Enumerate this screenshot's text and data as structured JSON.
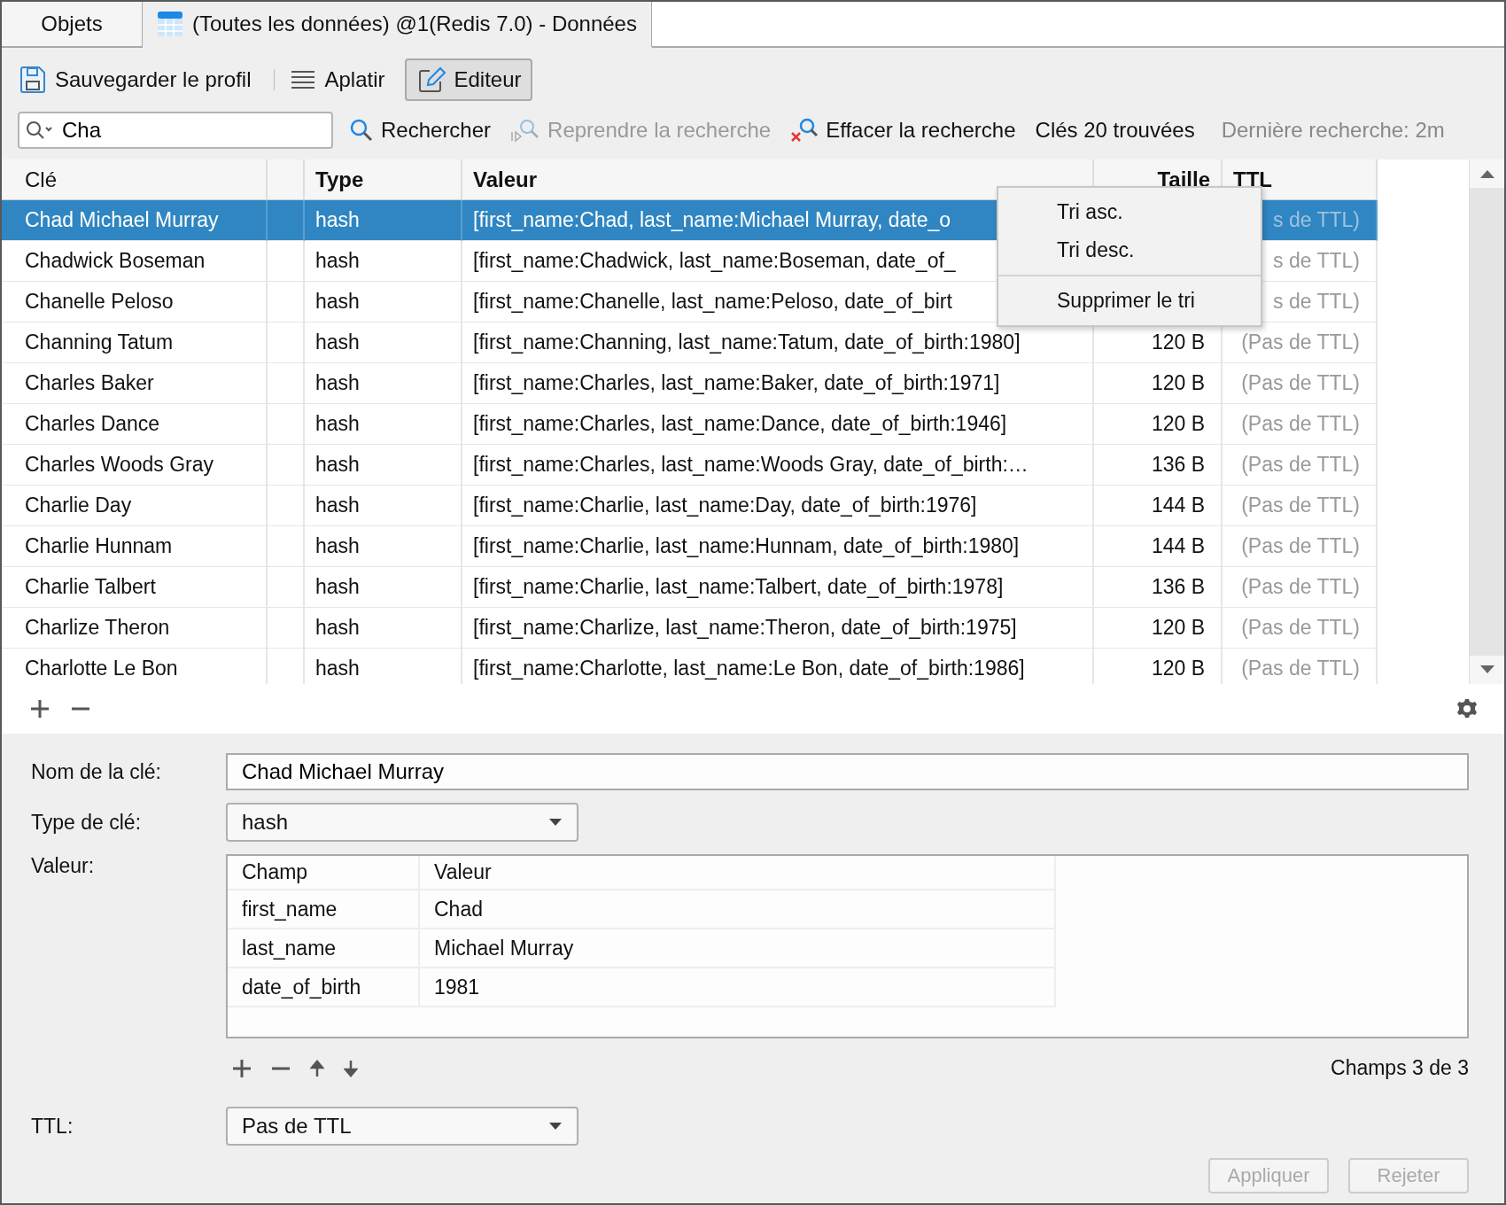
{
  "tabs": [
    {
      "label": "Objets",
      "selected": false,
      "kind": "plain"
    },
    {
      "label": "(Toutes les données) @1(Redis 7.0) - Données",
      "selected": true,
      "kind": "table"
    }
  ],
  "toolbar": [
    {
      "label": "Sauvegarder le profil",
      "kind": "save",
      "pressed": false
    },
    {
      "label": "Aplatir",
      "kind": "flatten",
      "pressed": false
    },
    {
      "label": "Editeur",
      "kind": "edit",
      "pressed": true
    }
  ],
  "search": {
    "value": "Cha",
    "actions": [
      {
        "label": "Rechercher",
        "kind": "search",
        "disabled": false
      },
      {
        "label": "Reprendre la recherche",
        "kind": "resume",
        "disabled": true
      },
      {
        "label": "Effacer la recherche",
        "kind": "clear",
        "disabled": false
      }
    ],
    "result": "Clés 20 trouvées",
    "last_search": "Dernière recherche: 2m"
  },
  "table": {
    "columns": [
      {
        "label": "Clé",
        "bold": false
      },
      {
        "label": "Type",
        "bold": true
      },
      {
        "label": "Valeur",
        "bold": true
      },
      {
        "label": "Taille",
        "bold": true
      },
      {
        "label": "TTL",
        "bold": true
      }
    ],
    "rows": [
      {
        "key": "Chad Michael Murray",
        "type": "hash",
        "value": "[first_name:Chad, last_name:Michael Murray, date_o",
        "size": "",
        "ttl": "s de TTL)",
        "selected": true
      },
      {
        "key": "Chadwick Boseman",
        "type": "hash",
        "value": "[first_name:Chadwick, last_name:Boseman, date_of_",
        "size": "",
        "ttl": "s de TTL)",
        "selected": false
      },
      {
        "key": "Chanelle Peloso",
        "type": "hash",
        "value": "[first_name:Chanelle, last_name:Peloso, date_of_birt",
        "size": "",
        "ttl": "s de TTL)",
        "selected": false
      },
      {
        "key": "Channing Tatum",
        "type": "hash",
        "value": "[first_name:Channing, last_name:Tatum, date_of_birth:1980]",
        "size": "120 B",
        "ttl": "(Pas de TTL)",
        "selected": false
      },
      {
        "key": "Charles Baker",
        "type": "hash",
        "value": "[first_name:Charles, last_name:Baker, date_of_birth:1971]",
        "size": "120 B",
        "ttl": "(Pas de TTL)",
        "selected": false
      },
      {
        "key": "Charles Dance",
        "type": "hash",
        "value": "[first_name:Charles, last_name:Dance, date_of_birth:1946]",
        "size": "120 B",
        "ttl": "(Pas de TTL)",
        "selected": false
      },
      {
        "key": "Charles Woods Gray",
        "type": "hash",
        "value": "[first_name:Charles, last_name:Woods Gray, date_of_birth:…",
        "size": "136 B",
        "ttl": "(Pas de TTL)",
        "selected": false
      },
      {
        "key": "Charlie Day",
        "type": "hash",
        "value": "[first_name:Charlie, last_name:Day, date_of_birth:1976]",
        "size": "144 B",
        "ttl": "(Pas de TTL)",
        "selected": false
      },
      {
        "key": "Charlie Hunnam",
        "type": "hash",
        "value": "[first_name:Charlie, last_name:Hunnam, date_of_birth:1980]",
        "size": "144 B",
        "ttl": "(Pas de TTL)",
        "selected": false
      },
      {
        "key": "Charlie Talbert",
        "type": "hash",
        "value": "[first_name:Charlie, last_name:Talbert, date_of_birth:1978]",
        "size": "136 B",
        "ttl": "(Pas de TTL)",
        "selected": false
      },
      {
        "key": "Charlize Theron",
        "type": "hash",
        "value": "[first_name:Charlize, last_name:Theron, date_of_birth:1975]",
        "size": "120 B",
        "ttl": "(Pas de TTL)",
        "selected": false
      },
      {
        "key": "Charlotte Le Bon",
        "type": "hash",
        "value": "[first_name:Charlotte, last_name:Le Bon, date_of_birth:1986]",
        "size": "120 B",
        "ttl": "(Pas de TTL)",
        "selected": false
      }
    ]
  },
  "context_menu": {
    "items": [
      {
        "label": "Tri asc.",
        "separator_before": false
      },
      {
        "label": "Tri desc.",
        "separator_before": false
      },
      {
        "label": "Supprimer le tri",
        "separator_before": true
      }
    ]
  },
  "editor": {
    "key_name_label": "Nom de la clé:",
    "key_name": "Chad Michael Murray",
    "key_type_label": "Type de clé:",
    "key_type": "hash",
    "value_label": "Valeur:",
    "fields": {
      "columns": [
        "Champ",
        "Valeur"
      ],
      "rows": [
        {
          "field": "first_name",
          "value": "Chad"
        },
        {
          "field": "last_name",
          "value": "Michael Murray"
        },
        {
          "field": "date_of_birth",
          "value": "1981"
        }
      ]
    },
    "fields_count": "Champs 3 de 3",
    "ttl_label": "TTL:",
    "ttl": "Pas de TTL",
    "buttons": [
      {
        "label": "Appliquer",
        "disabled": true
      },
      {
        "label": "Rejeter",
        "disabled": true
      }
    ]
  }
}
